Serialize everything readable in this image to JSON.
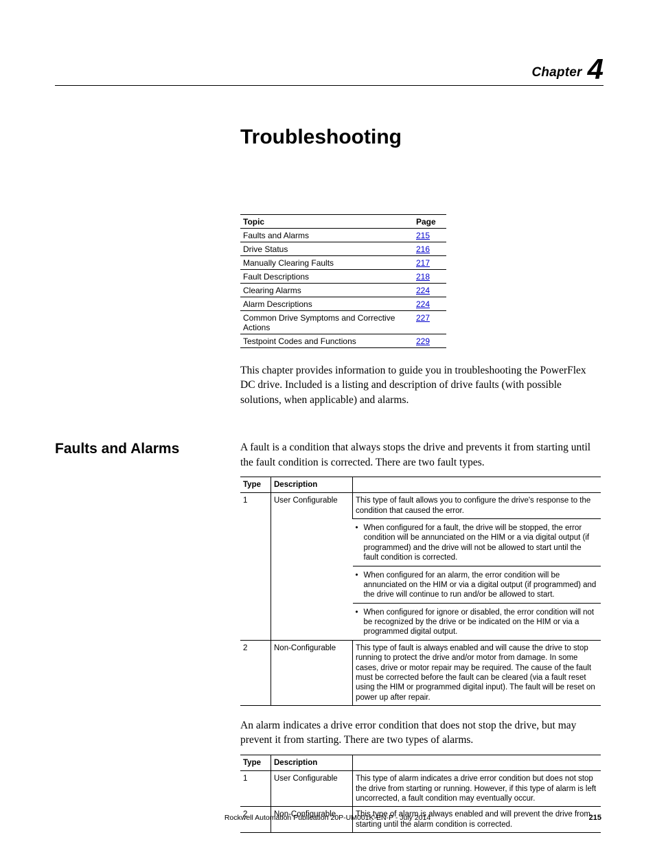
{
  "chapter": {
    "label": "Chapter",
    "number": "4"
  },
  "title": "Troubleshooting",
  "topic_table": {
    "headers": {
      "topic": "Topic",
      "page": "Page"
    },
    "rows": [
      {
        "topic": "Faults and Alarms",
        "page": "215"
      },
      {
        "topic": "Drive Status",
        "page": "216"
      },
      {
        "topic": "Manually Clearing Faults",
        "page": "217"
      },
      {
        "topic": "Fault Descriptions",
        "page": "218"
      },
      {
        "topic": "Clearing Alarms",
        "page": "224"
      },
      {
        "topic": "Alarm Descriptions",
        "page": "224"
      },
      {
        "topic": "Common Drive Symptoms and Corrective Actions",
        "page": "227"
      },
      {
        "topic": "Testpoint Codes and Functions",
        "page": "229"
      }
    ]
  },
  "intro_paragraph": "This chapter provides information to guide you in troubleshooting the PowerFlex DC drive. Included is a listing and description of drive faults (with possible solutions, when applicable) and alarms.",
  "section": {
    "heading": "Faults and Alarms",
    "para1": "A fault is a condition that always stops the drive and prevents it from starting until the fault condition is corrected. There are two fault types.",
    "fault_table": {
      "headers": {
        "type": "Type",
        "description": "Description"
      },
      "row1": {
        "type": "1",
        "name": "User Configurable",
        "lead": "This type of fault allows you to configure the drive's response to the condition that caused the error.",
        "b1": "When configured for a fault, the drive will be stopped, the error condition will be annunciated on the HIM or a via digital output (if programmed) and the drive will not be allowed to start until the fault condition is corrected.",
        "b2": "When configured for an alarm, the error condition will be annunciated on the HIM or via a digital output (if programmed) and the drive will continue to run and/or be allowed to start.",
        "b3": "When configured for ignore or disabled, the error condition will not be recognized by the drive or be indicated on the HIM or via a programmed digital output."
      },
      "row2": {
        "type": "2",
        "name": "Non-Configurable",
        "desc": "This type of fault is always enabled and will cause the drive to stop running to protect the drive and/or motor from damage. In some cases, drive or motor repair may be required. The cause of the fault must be corrected before the fault can be cleared (via a fault reset using the HIM or programmed digital input). The fault will be reset on power up after repair."
      }
    },
    "para2": "An alarm indicates a drive error condition that does not stop the drive, but may prevent it from starting. There are two types of alarms.",
    "alarm_table": {
      "headers": {
        "type": "Type",
        "description": "Description"
      },
      "row1": {
        "type": "1",
        "name": "User Configurable",
        "desc": "This type of alarm indicates a drive error condition but does not stop the drive from starting or running. However, if this type of alarm is left uncorrected, a fault condition may eventually occur."
      },
      "row2": {
        "type": "2",
        "name": "Non-Configurable",
        "desc": "This type of alarm is always enabled and will prevent the drive from starting until the alarm condition is corrected."
      }
    }
  },
  "footer": {
    "text": "Rockwell Automation Publication 20P-UM001K-EN-P - July 2014",
    "page": "215"
  }
}
